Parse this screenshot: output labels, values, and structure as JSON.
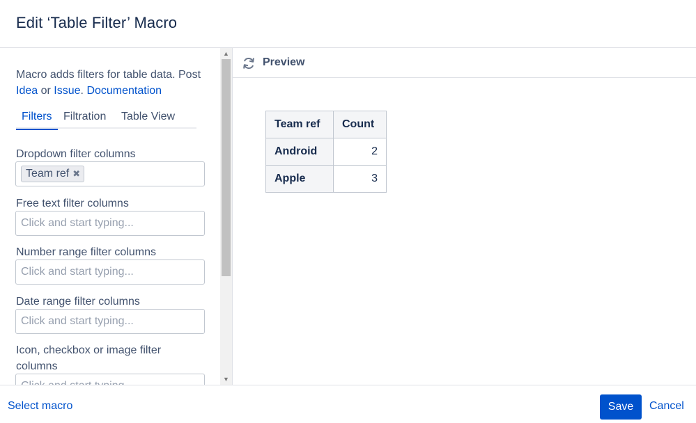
{
  "dialog": {
    "title": "Edit ‘Table Filter’ Macro"
  },
  "description": {
    "text": "Macro adds filters for table data. Post",
    "link_idea": "Idea",
    "or": "or",
    "link_issue": "Issue",
    "period": ".",
    "link_documentation": "Documentation"
  },
  "tabs": [
    {
      "label": "Filters",
      "active": true
    },
    {
      "label": "Filtration",
      "active": false
    },
    {
      "label": "Table View",
      "active": false
    }
  ],
  "fields": {
    "dropdown": {
      "label": "Dropdown filter columns",
      "chips": [
        "Team ref"
      ],
      "chip_remove_icon": "✖"
    },
    "free_text": {
      "label": "Free text filter columns",
      "placeholder": "Click and start typing..."
    },
    "number_range": {
      "label": "Number range filter columns",
      "placeholder": "Click and start typing..."
    },
    "date_range": {
      "label": "Date range filter columns",
      "placeholder": "Click and start typing..."
    },
    "icon_checkbox": {
      "label": "Icon, checkbox or image filter columns",
      "placeholder": "Click and start typing..."
    }
  },
  "scrollbar": {
    "up": "▲",
    "down": "▼"
  },
  "preview": {
    "title": "Preview",
    "icon": "refresh-icon",
    "table": {
      "headers": [
        "Team ref",
        "Count"
      ],
      "rows": [
        [
          "Android",
          "2"
        ],
        [
          "Apple",
          "3"
        ]
      ]
    }
  },
  "footer": {
    "select_macro": "Select macro",
    "save": "Save",
    "cancel": "Cancel"
  },
  "colors": {
    "accent": "#0052cc",
    "text": "#172b4d",
    "muted": "#42526e",
    "border": "#dfe1e6"
  }
}
